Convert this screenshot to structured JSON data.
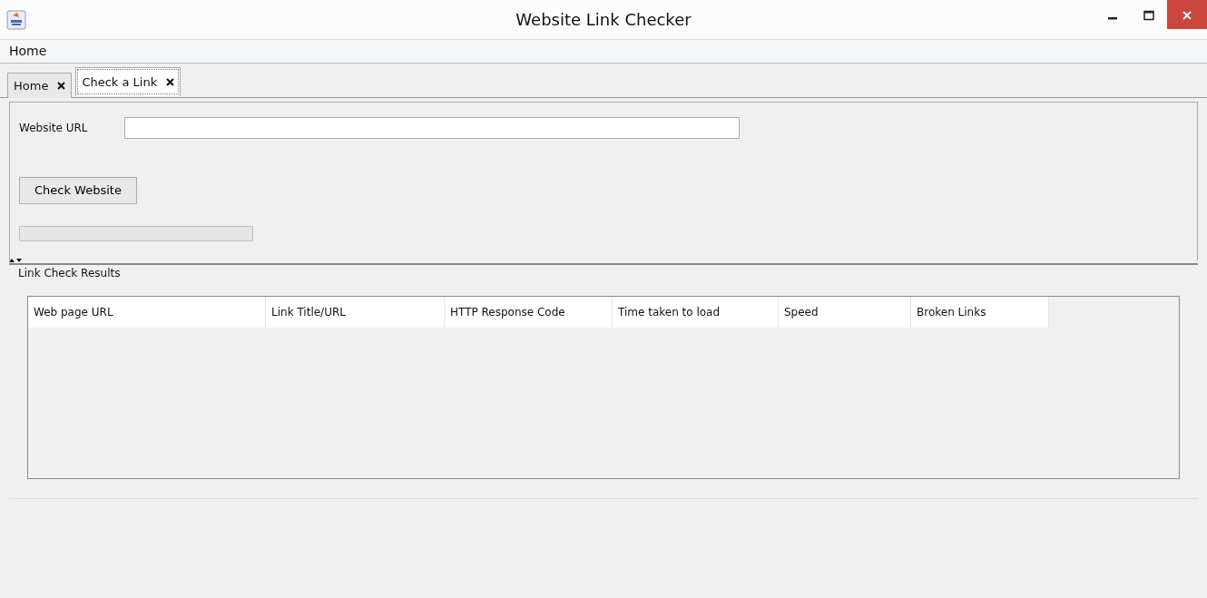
{
  "window": {
    "title": "Website Link Checker"
  },
  "menu": [
    {
      "label": "Home"
    }
  ],
  "tabs": [
    {
      "label": "Home",
      "selected": false
    },
    {
      "label": "Check a Link",
      "selected": true
    }
  ],
  "form": {
    "url_label": "Website URL",
    "check_button": "Check Website",
    "progress": {
      "level": 0
    }
  },
  "results": {
    "title": "Link Check Results",
    "table": {
      "columns": [
        "Web page URL",
        "Link Title/URL",
        "HTTP Response Code",
        "Time taken to load",
        "Speed",
        "Broken Links"
      ]
    }
  }
}
